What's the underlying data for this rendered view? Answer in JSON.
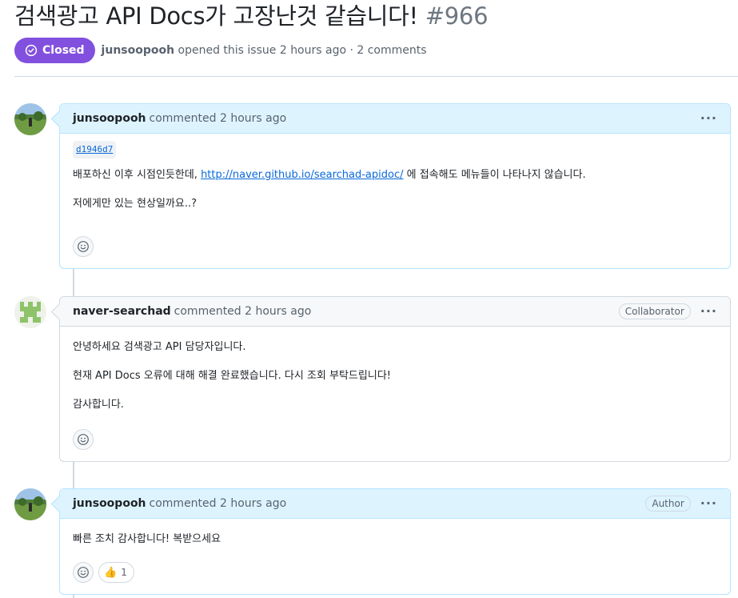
{
  "issue": {
    "title": "검색광고 API Docs가 고장난것 같습니다!",
    "number": "#966",
    "state_label": "Closed",
    "state_color": "#8250df",
    "author": "junsoopooh",
    "meta_text": "opened this issue 2 hours ago · 2 comments"
  },
  "comments": [
    {
      "author": "junsoopooh",
      "action": "commented 2 hours ago",
      "role": "",
      "avatar": "landscape-avatar",
      "commit_ref": "d1946d7",
      "line1_before": "배포하신 이후 시점인듯한데, ",
      "line1_link": "http://naver.github.io/searchad-apidoc/",
      "line1_after": " 에 접속해도 메뉴들이 나타나지 않습니다.",
      "line2": "저에게만 있는 현상일까요..?"
    },
    {
      "author": "naver-searchad",
      "action": "commented 2 hours ago",
      "role": "Collaborator",
      "avatar": "identicon-avatar",
      "line1": "안녕하세요 검색광고 API 담당자입니다.",
      "line2": "현재 API Docs 오류에 대해 해결 완료했습니다. 다시 조회 부탁드립니다!",
      "line3": "감사합니다."
    },
    {
      "author": "junsoopooh",
      "action": "commented 2 hours ago",
      "role": "Author",
      "avatar": "landscape-avatar",
      "line1": "빠른 조치 감사합니다! 복받으세요",
      "reaction_emoji": "👍",
      "reaction_count": "1"
    }
  ],
  "icons": {
    "closed": "check-circle-icon",
    "menu": "kebab-horizontal-icon",
    "reaction": "smiley-icon"
  },
  "colors": {
    "closed_badge": "#8250df",
    "author_header": "#ddf4ff",
    "other_header": "#f6f8fa",
    "link": "#0969da"
  }
}
